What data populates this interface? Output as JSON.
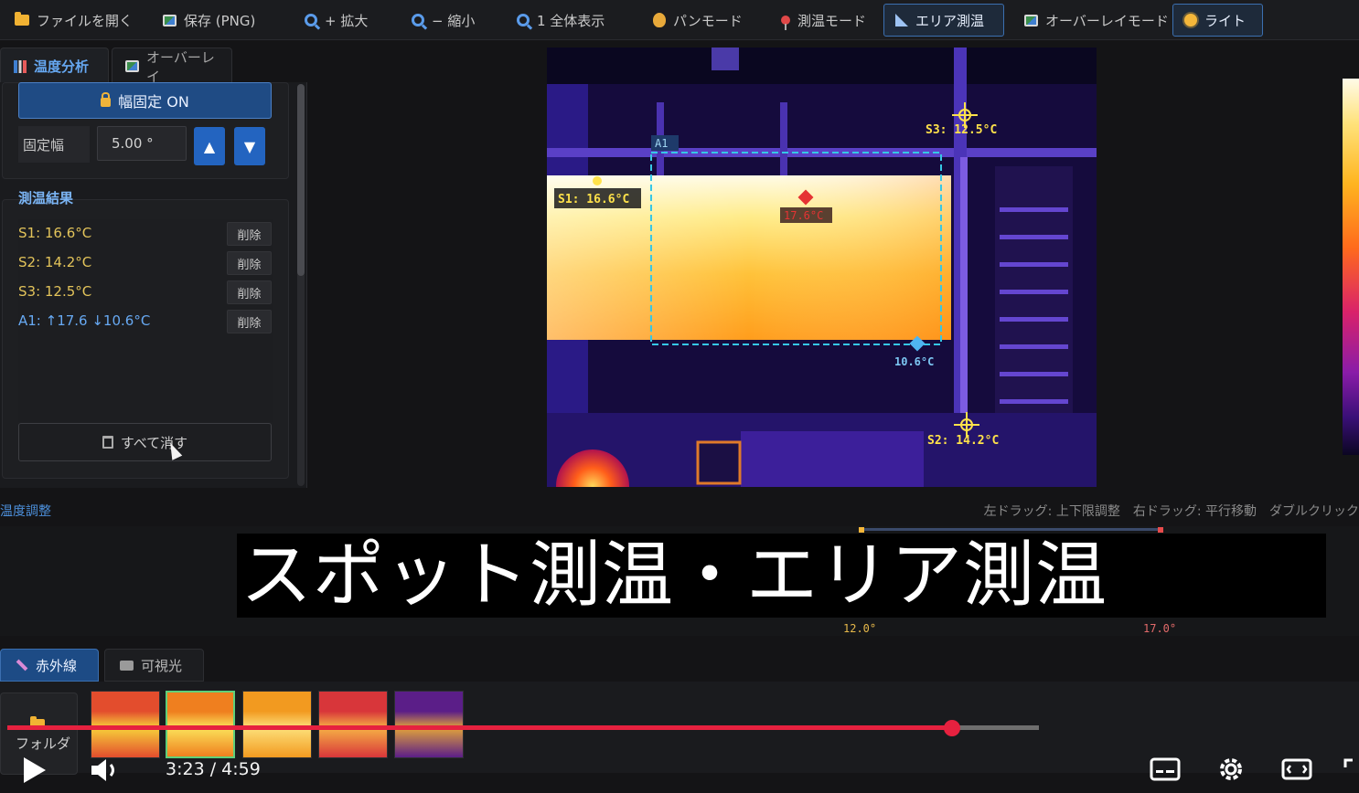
{
  "toolbar": {
    "buttons": [
      {
        "icon": "folder-icon",
        "label": "ファイルを開く"
      },
      {
        "icon": "image-icon",
        "label": "保存 (PNG)"
      },
      {
        "icon": "zoom-in-icon",
        "label": "+ 拡大"
      },
      {
        "icon": "zoom-out-icon",
        "label": "− 縮小"
      },
      {
        "icon": "fit-icon",
        "label": "1 全体表示"
      },
      {
        "icon": "hand-icon",
        "label": "パンモード"
      },
      {
        "icon": "pin-icon",
        "label": "測温モード"
      },
      {
        "icon": "area-icon",
        "label": "エリア測温",
        "active": true
      },
      {
        "icon": "image-icon",
        "label": "オーバーレイモード"
      },
      {
        "icon": "sun-icon",
        "label": "ライト",
        "active": true
      }
    ]
  },
  "left_tabs": [
    {
      "label": "温度分析",
      "active": true
    },
    {
      "label": "オーバーレイ",
      "active": false
    }
  ],
  "width_lock": {
    "button_label": "幅固定 ON",
    "field_label": "固定幅",
    "field_value": "5.00 °",
    "up_label": "▲",
    "down_label": "▼"
  },
  "results": {
    "title": "測温結果",
    "rows": [
      {
        "text": "S1: 16.6°C",
        "delete_label": "削除",
        "kind": "spot"
      },
      {
        "text": "S2: 14.2°C",
        "delete_label": "削除",
        "kind": "spot"
      },
      {
        "text": "S3: 12.5°C",
        "delete_label": "削除",
        "kind": "spot"
      },
      {
        "text": "A1: ↑17.6 ↓10.6°C",
        "delete_label": "削除",
        "kind": "area"
      }
    ],
    "clear_all_label": "すべて消す"
  },
  "thermal": {
    "area_label": "A1",
    "spots": [
      {
        "label": "S1: 16.6°C"
      },
      {
        "label": "S3: 12.5°C"
      },
      {
        "label": "S2: 14.2°C"
      }
    ],
    "max_label": "17.6°C",
    "min_label": "10.6°C"
  },
  "temp_adjust": {
    "label": "温度調整",
    "hint": "左ドラッグ: 上下限調整　右ドラッグ: 平行移動　ダブルクリック"
  },
  "histogram": {
    "low_label": "12.0°",
    "high_label": "17.0°",
    "colors": {
      "low": "#f4b63a",
      "high": "#e84b4b"
    }
  },
  "caption": "スポット測温・エリア測温",
  "bottom_tabs": [
    {
      "label": "赤外線",
      "active": true
    },
    {
      "label": "可視光",
      "active": false
    }
  ],
  "folder_label": "フォルダ",
  "thumbnails": [
    {
      "colors": [
        "#e34d2d",
        "#f7d13a"
      ],
      "selected": false
    },
    {
      "colors": [
        "#ef7f1f",
        "#fbe35a"
      ],
      "selected": true
    },
    {
      "colors": [
        "#f29a20",
        "#fde07a"
      ],
      "selected": false
    },
    {
      "colors": [
        "#d8363a",
        "#f6b145"
      ],
      "selected": false
    },
    {
      "colors": [
        "#5b1e88",
        "#e2a33a"
      ],
      "selected": false
    }
  ],
  "video": {
    "time_label": "3:23 / 4:59",
    "progress": 0.916,
    "accent": "#e6213f"
  }
}
